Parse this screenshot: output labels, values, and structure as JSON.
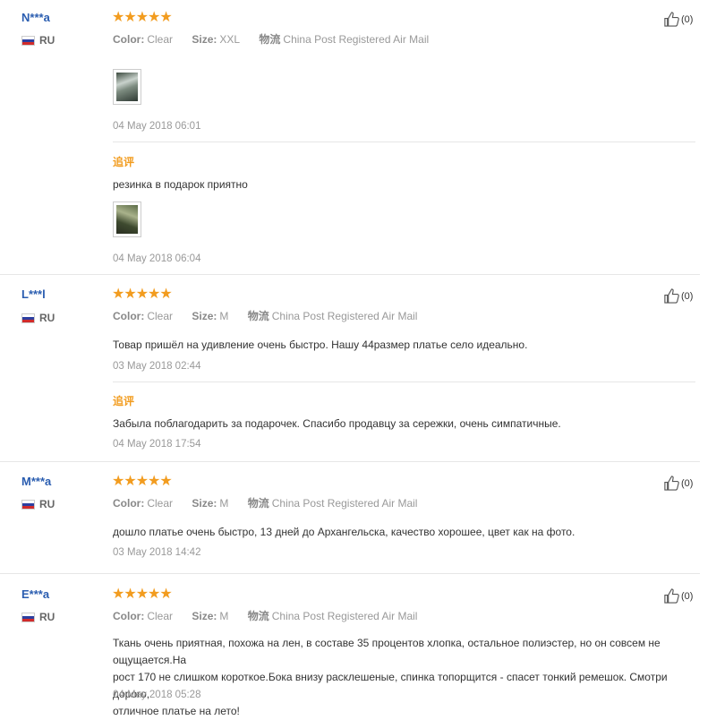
{
  "labels": {
    "color": "Color:",
    "size": "Size:",
    "shipping": "物流",
    "followup": "追评",
    "stars": "★★★★★"
  },
  "reviews": [
    {
      "user": "N***a",
      "country": "RU",
      "color": "Clear",
      "size": "XXL",
      "shipping": "China Post Registered Air Mail",
      "likes": "(0)",
      "date": "04 May 2018 06:01",
      "followup_text": "резинка в подарок приятно",
      "followup_date": "04 May 2018 06:04"
    },
    {
      "user": "L***l",
      "country": "RU",
      "color": "Clear",
      "size": "M",
      "shipping": "China Post Registered Air Mail",
      "likes": "(0)",
      "text": "Товар пришёл на удивление очень быстро. Нашу 44размер платье село идеально.",
      "date": "03 May 2018 02:44",
      "followup_text": "Забыла поблагодарить за подарочек. Спасибо продавцу за сережки, очень симпатичные.",
      "followup_date": "04 May 2018 17:54"
    },
    {
      "user": "M***a",
      "country": "RU",
      "color": "Clear",
      "size": "M",
      "shipping": "China Post Registered Air Mail",
      "likes": "(0)",
      "text": "дошло платье очень быстро, 13 дней до Архангельска, качество хорошее, цвет как на фото.",
      "date": "03 May 2018 14:42"
    },
    {
      "user": "E***a",
      "country": "RU",
      "color": "Clear",
      "size": "M",
      "shipping": "China Post Registered Air Mail",
      "likes": "(0)",
      "text_lines": [
        "Ткань очень приятная, похожа на лен, в составе 35 процентов хлопка, остальное полиэстер, но он совсем не ощущается.На",
        "рост 170 не слишком короткое.Бока внизу расклешеные, спинка топорщится - спасет тонкий ремешок. Смотри дорого,",
        "отличное платье на лето!"
      ],
      "date": "04 May 2018 05:28"
    }
  ]
}
